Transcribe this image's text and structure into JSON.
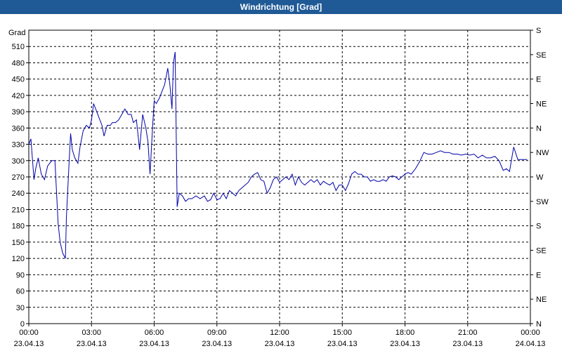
{
  "window": {
    "title": "Windrichtung [Grad]"
  },
  "chart_data": {
    "type": "line",
    "title": "Windrichtung [Grad]",
    "ylabel": "Grad",
    "ylim": [
      0,
      540
    ],
    "xlim": [
      "23.04.13 00:00",
      "24.04.13 00:00"
    ],
    "y_ticks": [
      0,
      30,
      60,
      90,
      120,
      150,
      180,
      210,
      240,
      270,
      300,
      330,
      360,
      390,
      420,
      450,
      480,
      510
    ],
    "right_ticks": [
      {
        "value": 0,
        "label": "N"
      },
      {
        "value": 45,
        "label": "NE"
      },
      {
        "value": 90,
        "label": "E"
      },
      {
        "value": 135,
        "label": "SE"
      },
      {
        "value": 180,
        "label": "S"
      },
      {
        "value": 225,
        "label": "SW"
      },
      {
        "value": 270,
        "label": "W"
      },
      {
        "value": 315,
        "label": "NW"
      },
      {
        "value": 360,
        "label": "N"
      },
      {
        "value": 405,
        "label": "NE"
      },
      {
        "value": 450,
        "label": "E"
      },
      {
        "value": 495,
        "label": "SE"
      },
      {
        "value": 540,
        "label": "S"
      }
    ],
    "x_ticks": [
      {
        "time": "00:00",
        "date": "23.04.13"
      },
      {
        "time": "03:00",
        "date": "23.04.13"
      },
      {
        "time": "06:00",
        "date": "23.04.13"
      },
      {
        "time": "09:00",
        "date": "23.04.13"
      },
      {
        "time": "12:00",
        "date": "23.04.13"
      },
      {
        "time": "15:00",
        "date": "23.04.13"
      },
      {
        "time": "18:00",
        "date": "23.04.13"
      },
      {
        "time": "21:00",
        "date": "23.04.13"
      },
      {
        "time": "00:00",
        "date": "24.04.13"
      }
    ],
    "grid": true,
    "line_color": "#0000aa",
    "series": [
      {
        "x_hours": [
          0,
          0.1,
          0.25,
          0.33,
          0.45,
          0.6,
          0.75,
          0.9,
          1.1,
          1.25,
          1.4,
          1.5,
          1.62,
          1.75,
          1.8,
          1.92,
          2.0,
          2.08,
          2.2,
          2.35,
          2.45,
          2.6,
          2.75,
          2.9,
          3.0,
          3.1,
          3.2,
          3.35,
          3.5,
          3.6,
          3.75,
          3.9,
          4.0,
          4.15,
          4.3,
          4.45,
          4.6,
          4.75,
          4.9,
          5.0,
          5.15,
          5.3,
          5.45,
          5.6,
          5.7,
          5.8,
          5.92,
          6.0,
          6.1,
          6.25,
          6.4,
          6.5,
          6.65,
          6.75,
          6.85,
          6.92,
          7.0,
          7.1,
          7.2,
          7.35,
          7.5,
          7.65,
          7.8,
          8.0,
          8.2,
          8.4,
          8.55,
          8.7,
          8.85,
          9.0,
          9.15,
          9.3,
          9.45,
          9.6,
          9.75,
          9.9,
          10.05,
          10.2,
          10.35,
          10.5,
          10.65,
          10.8,
          10.95,
          11.1,
          11.25,
          11.4,
          11.55,
          11.7,
          11.85,
          12.0,
          12.15,
          12.3,
          12.45,
          12.6,
          12.75,
          12.9,
          13.05,
          13.2,
          13.35,
          13.5,
          13.65,
          13.8,
          13.95,
          14.1,
          14.25,
          14.4,
          14.55,
          14.7,
          14.85,
          15.0,
          15.15,
          15.3,
          15.45,
          15.6,
          15.75,
          15.9,
          16.05,
          16.2,
          16.35,
          16.5,
          16.65,
          16.8,
          16.95,
          17.1,
          17.25,
          17.4,
          17.55,
          17.7,
          17.85,
          18.0,
          18.15,
          18.3,
          18.5,
          18.7,
          18.9,
          19.1,
          19.3,
          19.5,
          19.7,
          19.9,
          20.1,
          20.3,
          20.5,
          20.7,
          20.9,
          21.1,
          21.3,
          21.5,
          21.7,
          21.9,
          22.1,
          22.3,
          22.5,
          22.7,
          22.85,
          23.0,
          23.2,
          23.4,
          23.55,
          23.7,
          23.85,
          24.0
        ],
        "values": [
          330,
          340,
          265,
          285,
          305,
          275,
          265,
          290,
          300,
          300,
          185,
          150,
          130,
          120,
          195,
          290,
          350,
          320,
          305,
          295,
          325,
          355,
          365,
          360,
          375,
          405,
          395,
          380,
          365,
          345,
          365,
          365,
          370,
          370,
          375,
          385,
          395,
          385,
          385,
          370,
          375,
          320,
          385,
          360,
          335,
          275,
          360,
          410,
          405,
          415,
          430,
          440,
          470,
          440,
          395,
          480,
          500,
          215,
          240,
          235,
          225,
          230,
          230,
          235,
          230,
          235,
          225,
          228,
          240,
          228,
          230,
          240,
          230,
          245,
          240,
          235,
          245,
          250,
          255,
          260,
          270,
          275,
          278,
          265,
          262,
          240,
          250,
          265,
          270,
          260,
          265,
          270,
          265,
          275,
          255,
          270,
          260,
          255,
          260,
          265,
          260,
          265,
          255,
          262,
          258,
          255,
          260,
          245,
          255,
          255,
          245,
          258,
          275,
          280,
          275,
          275,
          270,
          270,
          262,
          265,
          262,
          262,
          265,
          262,
          270,
          272,
          270,
          265,
          270,
          275,
          278,
          275,
          285,
          298,
          315,
          312,
          312,
          315,
          318,
          315,
          315,
          312,
          312,
          310,
          312,
          310,
          312,
          305,
          310,
          305,
          305,
          308,
          300,
          282,
          285,
          280,
          325,
          302,
          302,
          302,
          302
        ]
      }
    ]
  }
}
